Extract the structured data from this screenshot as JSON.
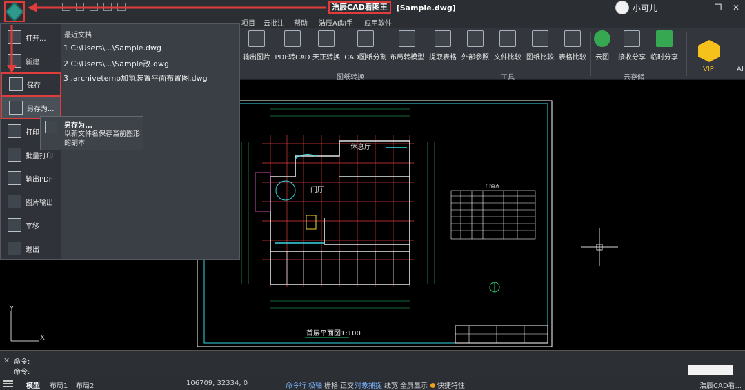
{
  "titlebar": {
    "app_name": "浩辰CAD看图王",
    "file_name": "[Sample.dwg]",
    "user_name": "小可儿"
  },
  "ribbon_tabs": [
    "项目",
    "云批注",
    "帮助",
    "浩辰AI助手",
    "应用软件"
  ],
  "ribbon_buttons": [
    {
      "label": "输出图片",
      "icon": "image-export-icon"
    },
    {
      "label": "PDF转CAD",
      "icon": "pdf-to-cad-icon"
    },
    {
      "label": "天正转换",
      "icon": "tangent-convert-icon"
    },
    {
      "label": "CAD图纸分割",
      "icon": "drawing-split-icon"
    },
    {
      "label": "布局转模型",
      "icon": "layout-to-model-icon"
    },
    {
      "label": "提取表格",
      "icon": "extract-table-icon"
    },
    {
      "label": "外部参照",
      "icon": "xref-icon"
    },
    {
      "label": "文件比较",
      "icon": "file-compare-icon"
    },
    {
      "label": "图纸比较",
      "icon": "drawing-compare-icon"
    },
    {
      "label": "表格比较",
      "icon": "table-compare-icon"
    },
    {
      "label": "云图",
      "icon": "cloud-icon"
    },
    {
      "label": "接收分享",
      "icon": "receive-share-icon"
    },
    {
      "label": "临时分享",
      "icon": "temp-share-icon"
    }
  ],
  "ribbon_groups": [
    "图纸转换",
    "工具",
    "云存储"
  ],
  "vip_label": "VIP",
  "ai_label": "AI",
  "file_menu": {
    "items": [
      {
        "label": "打开...",
        "icon": "open-folder-icon"
      },
      {
        "label": "新建",
        "icon": "new-file-icon"
      },
      {
        "label": "保存",
        "icon": "save-icon"
      },
      {
        "label": "另存为...",
        "icon": "save-as-icon"
      },
      {
        "label": "打印...",
        "icon": "print-icon"
      },
      {
        "label": "批量打印",
        "icon": "batch-print-icon"
      },
      {
        "label": "输出PDF",
        "icon": "export-pdf-icon"
      },
      {
        "label": "图片输出",
        "icon": "image-output-icon"
      },
      {
        "label": "平移",
        "icon": "pan-hand-icon"
      },
      {
        "label": "退出",
        "icon": "exit-icon"
      }
    ],
    "recent_title": "最近文档",
    "recent_files": [
      "1 C:\\Users\\...\\Sample.dwg",
      "2 C:\\Users\\...\\Sample改.dwg",
      "3 .archivetemp加氢装置平面布置图.dwg"
    ]
  },
  "tooltip": {
    "title": "另存为...",
    "description": "以新文件名保存当前图形的副本"
  },
  "drawing": {
    "room_rest": "休息厅",
    "room_hall": "门厅",
    "plan_title": "首层平面图1:100",
    "table_title": "门窗表"
  },
  "command": {
    "line1": "命令:",
    "line2": "命令:"
  },
  "statusbar": {
    "model_tab": "模型",
    "layout1": "布局1",
    "layout2": "布局2",
    "coords": "106709, 32334, 0",
    "toggles": [
      "命令行",
      "极轴",
      "栅格",
      "正交",
      "对象捕捉",
      "线宽",
      "全屏显示"
    ],
    "quick_props": "快捷特性",
    "app_footer": "浩辰CAD看..."
  },
  "colors": {
    "highlight": "#e03c3c",
    "drawing_frame": "#ffffff",
    "axis_red": "#e03c3c",
    "wall_cyan": "#37d8e6",
    "dimension_green": "#2ecc71"
  }
}
